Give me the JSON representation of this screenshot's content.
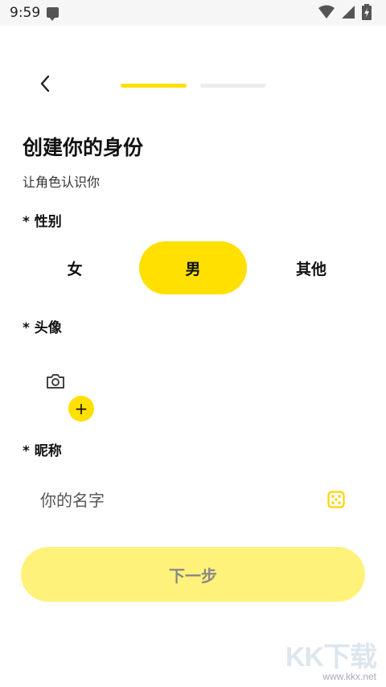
{
  "status_bar": {
    "time": "9:59"
  },
  "header": {
    "progress_step": 1,
    "progress_total": 2
  },
  "page": {
    "title": "创建你的身份",
    "subtitle": "让角色认识你"
  },
  "gender": {
    "label": "* 性别",
    "options": [
      "女",
      "男",
      "其他"
    ],
    "selected": "男"
  },
  "avatar": {
    "label": "* 头像",
    "add_symbol": "+"
  },
  "nickname": {
    "label": "* 昵称",
    "placeholder": "你的名字",
    "value": ""
  },
  "next_button": {
    "label": "下一步"
  },
  "watermark": {
    "big": "KK下载",
    "small": "www.kkx.net"
  },
  "colors": {
    "accent": "#FFE000",
    "button_disabled": "#FFF27A",
    "progress_inactive": "#ececec"
  },
  "icons": {
    "back": "chevron-left-icon",
    "camera": "camera-icon",
    "dice": "dice-icon"
  }
}
